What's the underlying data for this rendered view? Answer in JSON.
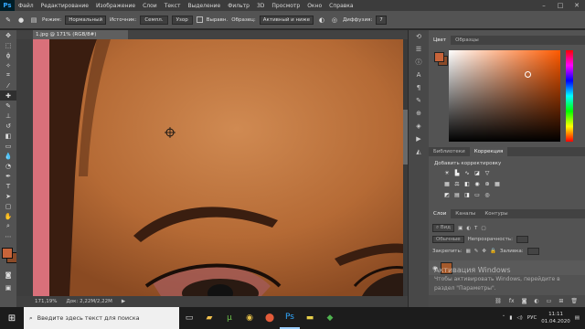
{
  "menu": {
    "logo": "Ps",
    "items": [
      "Файл",
      "Редактирование",
      "Изображение",
      "Слои",
      "Текст",
      "Выделение",
      "Фильтр",
      "3D",
      "Просмотр",
      "Окно",
      "Справка"
    ]
  },
  "options": {
    "mode_label": "Режим:",
    "mode_value": "Нормальный",
    "source_label": "Источник:",
    "source_sampled": "Семпл.",
    "source_pattern": "Узор",
    "align_label": "Выравн.",
    "sample_label": "Образец:",
    "sample_value": "Активный и ниже",
    "diffusion_label": "Диффузия:",
    "diffusion_value": "7"
  },
  "document": {
    "tab_title": "1.jpg @ 171% (RGB/8#)",
    "zoom": "171,19%",
    "doc_size": "Док: 2,22M/2,22M"
  },
  "panels": {
    "color_tabs": [
      "Цвет",
      "Образцы"
    ],
    "adjust_tabs": [
      "Библиотеки",
      "Коррекция"
    ],
    "adjust_heading": "Добавить корректировку",
    "layers_tabs": [
      "Слои",
      "Каналы",
      "Контуры"
    ],
    "blend_mode": "Обычные",
    "opacity_label": "Непрозрачность:",
    "lock_label": "Закрепить:",
    "fill_label": "Заливка:"
  },
  "watermark": {
    "line1": "Активация Windows",
    "line2": "Чтобы активировать Windows, перейдите в",
    "line3": "раздел \"Параметры\"."
  },
  "taskbar": {
    "search_placeholder": "Введите здесь текст для поиска",
    "lang": "РУС",
    "time": "11:11",
    "date": "01.04.2020"
  },
  "colors": {
    "foreground": "#c8643a",
    "background": "#8a4a28",
    "accent": "#31a8ff"
  }
}
